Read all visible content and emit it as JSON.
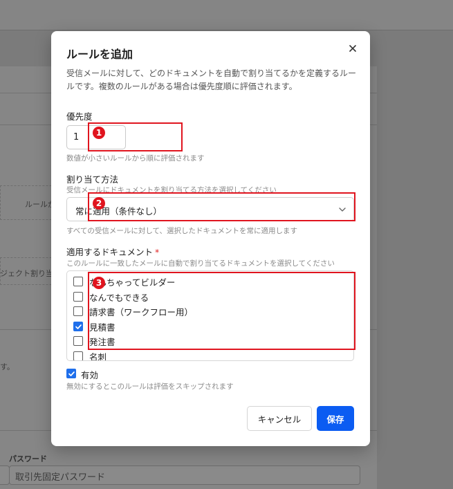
{
  "background": {
    "rule_text": "ルールが",
    "project_text": "ジェクト割り当",
    "desc_tail": "す。",
    "password_label": "パスワード",
    "password_placeholder": "取引先固定パスワード"
  },
  "modal": {
    "title": "ルールを追加",
    "description": "受信メールに対して、どのドキュメントを自動で割り当てるかを定義するルールです。複数のルールがある場合は優先度順に評価されます。",
    "priority": {
      "label": "優先度",
      "value": "1",
      "hint": "数値が小さいルールから順に評価されます"
    },
    "method": {
      "label": "割り当て方法",
      "hint_top": "受信メールにドキュメントを割り当てる方法を選択してください",
      "selected": "常に適用（条件なし）",
      "hint_bottom": "すべての受信メールに対して、選択したドキュメントを常に適用します"
    },
    "documents": {
      "label": "適用するドキュメント",
      "required_mark": "*",
      "hint": "このルールに一致したメールに自動で割り当てるドキュメントを選択してください",
      "items": [
        {
          "label": "なんちゃってビルダー",
          "checked": false
        },
        {
          "label": "なんでもできる",
          "checked": false
        },
        {
          "label": "請求書（ワークフロー用）",
          "checked": false
        },
        {
          "label": "見積書",
          "checked": true
        },
        {
          "label": "発注書",
          "checked": false
        },
        {
          "label": "名刺",
          "checked": false
        }
      ]
    },
    "enabled": {
      "label": "有効",
      "checked": true,
      "hint": "無効にするとこのルールは評価をスキップされます"
    },
    "buttons": {
      "cancel": "キャンセル",
      "save": "保存"
    }
  },
  "annotations": {
    "markers": [
      "1",
      "2",
      "3"
    ],
    "color": "#e0141e"
  },
  "colors": {
    "primary": "#0b5cf2",
    "checkbox_checked": "#1f6feb",
    "required": "#e02424"
  }
}
